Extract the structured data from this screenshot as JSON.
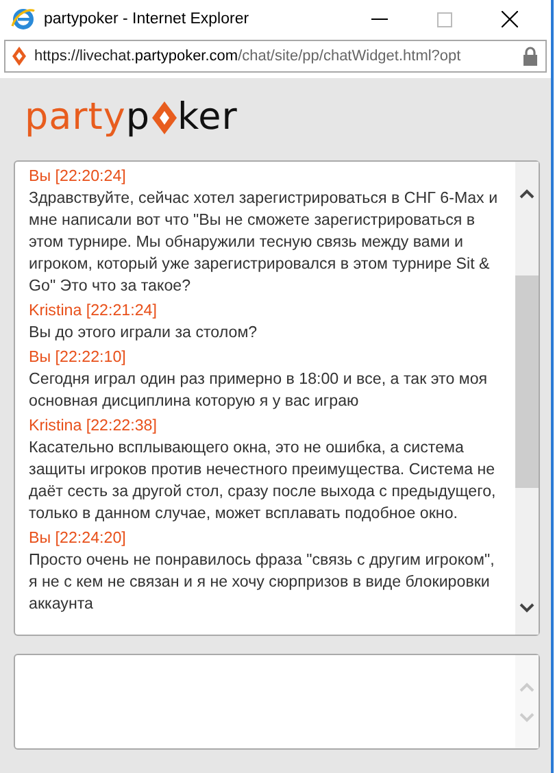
{
  "window": {
    "title": "partypoker - Internet Explorer"
  },
  "address_bar": {
    "url_prefix": "https://livechat.",
    "url_domain": "partypoker.com",
    "url_rest": "/chat/site/pp/chatWidget.html?opt"
  },
  "logo": {
    "part1": "party",
    "part2": "p",
    "part3": "ker"
  },
  "messages": [
    {
      "header": "Вы [22:20:24]",
      "text": "Здравствуйте, сейчас хотел зарегистрироваться в СНГ 6-Max и мне написали вот что \"Вы не сможете зарегистрироваться в этом турнире. Мы обнаружили тесную связь между вами и игроком, который уже зарегистрировался в этом турнире Sit & Go\" Это что за такое?"
    },
    {
      "header": "Kristina [22:21:24]",
      "text": "Вы до этого играли за столом?"
    },
    {
      "header": "Вы [22:22:10]",
      "text": "Сегодня играл один раз примерно в 18:00 и все, а так это моя основная дисциплина которую я у вас играю"
    },
    {
      "header": "Kristina [22:22:38]",
      "text": "Касательно всплывающего окна, это не ошибка, а система защиты игроков против нечестного преимущества. Система не даёт сесть за другой стол, сразу после выхода с предыдущего, только в данном случае, может всплавать подобное окно."
    },
    {
      "header": "Вы [22:24:20]",
      "text": "Просто очень не понравилось фраза \"связь с другим игроком\", я не с кем не связан и я не хочу сюрпризов в виде блокировки аккаунта"
    }
  ]
}
